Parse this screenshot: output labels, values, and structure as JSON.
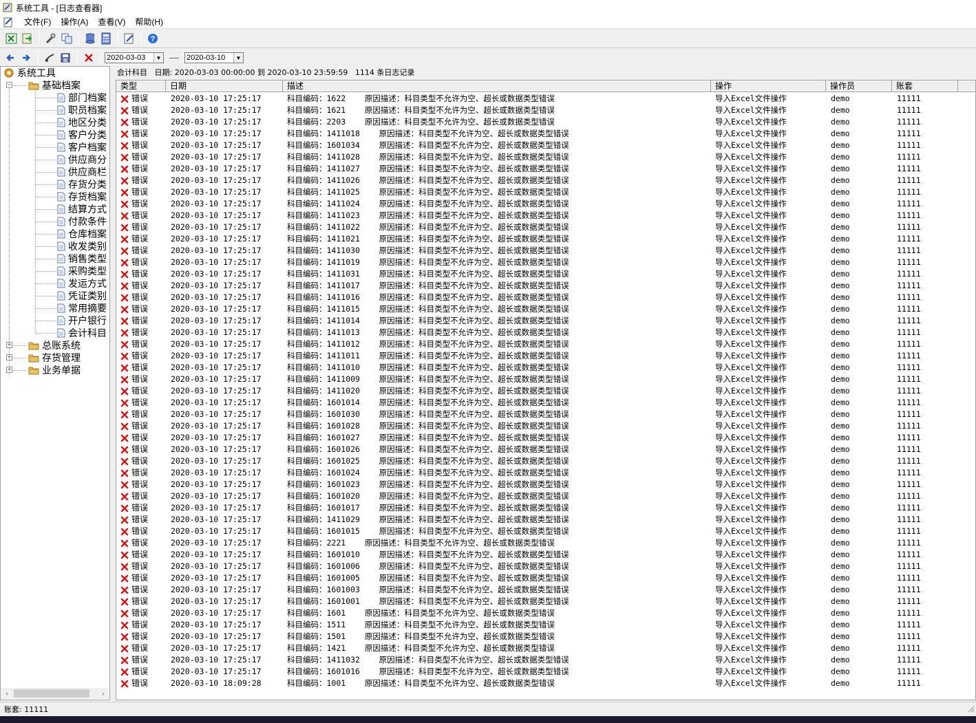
{
  "window": {
    "title": "系统工具 - [日志查看器]"
  },
  "menu": [
    {
      "label": "文件(F)"
    },
    {
      "label": "操作(A)"
    },
    {
      "label": "查看(V)"
    },
    {
      "label": "帮助(H)"
    }
  ],
  "filter": {
    "date_from": "2020-03-03",
    "date_to": "2020-03-10"
  },
  "tree": {
    "root": "系统工具",
    "groups": [
      {
        "label": "基础档案",
        "expanded": true,
        "children": [
          "部门档案",
          "职员档案",
          "地区分类",
          "客户分类",
          "客户档案",
          "供应商分",
          "供应商栏",
          "存货分类",
          "存货档案",
          "结算方式",
          "付款条件",
          "仓库档案",
          "收发类别",
          "销售类型",
          "采购类型",
          "发运方式",
          "凭证类别",
          "常用摘要",
          "开户银行",
          "会计科目"
        ]
      },
      {
        "label": "总账系统",
        "expanded": false
      },
      {
        "label": "存货管理",
        "expanded": false
      },
      {
        "label": "业务单据",
        "expanded": false
      }
    ]
  },
  "info": {
    "category": "会计科目",
    "date_label": "日期:",
    "range": "2020-03-03 00:00:00 到 2020-03-10 23:59:59",
    "count_text": "1114 条日志记录"
  },
  "columns": [
    "类型",
    "日期",
    "描述",
    "操作",
    "操作员",
    "账套"
  ],
  "rows": [
    {
      "type": "错误",
      "date": "2020-03-10 17:25:17",
      "desc": "科目编码：1622    原因描述：科目类型不允许为空、超长或数据类型错误",
      "op": "导入Excel文件操作",
      "user": "demo",
      "book": "11111"
    },
    {
      "type": "错误",
      "date": "2020-03-10 17:25:17",
      "desc": "科目编码：1621    原因描述：科目类型不允许为空、超长或数据类型错误",
      "op": "导入Excel文件操作",
      "user": "demo",
      "book": "11111"
    },
    {
      "type": "错误",
      "date": "2020-03-10 17:25:17",
      "desc": "科目编码：2203    原因描述：科目类型不允许为空、超长或数据类型错误",
      "op": "导入Excel文件操作",
      "user": "demo",
      "book": "11111"
    },
    {
      "type": "错误",
      "date": "2020-03-10 17:25:17",
      "desc": "科目编码：1411018    原因描述：科目类型不允许为空、超长或数据类型错误",
      "op": "导入Excel文件操作",
      "user": "demo",
      "book": "11111"
    },
    {
      "type": "错误",
      "date": "2020-03-10 17:25:17",
      "desc": "科目编码：1601034    原因描述：科目类型不允许为空、超长或数据类型错误",
      "op": "导入Excel文件操作",
      "user": "demo",
      "book": "11111"
    },
    {
      "type": "错误",
      "date": "2020-03-10 17:25:17",
      "desc": "科目编码：1411028    原因描述：科目类型不允许为空、超长或数据类型错误",
      "op": "导入Excel文件操作",
      "user": "demo",
      "book": "11111"
    },
    {
      "type": "错误",
      "date": "2020-03-10 17:25:17",
      "desc": "科目编码：1411027    原因描述：科目类型不允许为空、超长或数据类型错误",
      "op": "导入Excel文件操作",
      "user": "demo",
      "book": "11111"
    },
    {
      "type": "错误",
      "date": "2020-03-10 17:25:17",
      "desc": "科目编码：1411026    原因描述：科目类型不允许为空、超长或数据类型错误",
      "op": "导入Excel文件操作",
      "user": "demo",
      "book": "11111"
    },
    {
      "type": "错误",
      "date": "2020-03-10 17:25:17",
      "desc": "科目编码：1411025    原因描述：科目类型不允许为空、超长或数据类型错误",
      "op": "导入Excel文件操作",
      "user": "demo",
      "book": "11111"
    },
    {
      "type": "错误",
      "date": "2020-03-10 17:25:17",
      "desc": "科目编码：1411024    原因描述：科目类型不允许为空、超长或数据类型错误",
      "op": "导入Excel文件操作",
      "user": "demo",
      "book": "11111"
    },
    {
      "type": "错误",
      "date": "2020-03-10 17:25:17",
      "desc": "科目编码：1411023    原因描述：科目类型不允许为空、超长或数据类型错误",
      "op": "导入Excel文件操作",
      "user": "demo",
      "book": "11111"
    },
    {
      "type": "错误",
      "date": "2020-03-10 17:25:17",
      "desc": "科目编码：1411022    原因描述：科目类型不允许为空、超长或数据类型错误",
      "op": "导入Excel文件操作",
      "user": "demo",
      "book": "11111"
    },
    {
      "type": "错误",
      "date": "2020-03-10 17:25:17",
      "desc": "科目编码：1411021    原因描述：科目类型不允许为空、超长或数据类型错误",
      "op": "导入Excel文件操作",
      "user": "demo",
      "book": "11111"
    },
    {
      "type": "错误",
      "date": "2020-03-10 17:25:17",
      "desc": "科目编码：1411030    原因描述：科目类型不允许为空、超长或数据类型错误",
      "op": "导入Excel文件操作",
      "user": "demo",
      "book": "11111"
    },
    {
      "type": "错误",
      "date": "2020-03-10 17:25:17",
      "desc": "科目编码：1411019    原因描述：科目类型不允许为空、超长或数据类型错误",
      "op": "导入Excel文件操作",
      "user": "demo",
      "book": "11111"
    },
    {
      "type": "错误",
      "date": "2020-03-10 17:25:17",
      "desc": "科目编码：1411031    原因描述：科目类型不允许为空、超长或数据类型错误",
      "op": "导入Excel文件操作",
      "user": "demo",
      "book": "11111"
    },
    {
      "type": "错误",
      "date": "2020-03-10 17:25:17",
      "desc": "科目编码：1411017    原因描述：科目类型不允许为空、超长或数据类型错误",
      "op": "导入Excel文件操作",
      "user": "demo",
      "book": "11111"
    },
    {
      "type": "错误",
      "date": "2020-03-10 17:25:17",
      "desc": "科目编码：1411016    原因描述：科目类型不允许为空、超长或数据类型错误",
      "op": "导入Excel文件操作",
      "user": "demo",
      "book": "11111"
    },
    {
      "type": "错误",
      "date": "2020-03-10 17:25:17",
      "desc": "科目编码：1411015    原因描述：科目类型不允许为空、超长或数据类型错误",
      "op": "导入Excel文件操作",
      "user": "demo",
      "book": "11111"
    },
    {
      "type": "错误",
      "date": "2020-03-10 17:25:17",
      "desc": "科目编码：1411014    原因描述：科目类型不允许为空、超长或数据类型错误",
      "op": "导入Excel文件操作",
      "user": "demo",
      "book": "11111"
    },
    {
      "type": "错误",
      "date": "2020-03-10 17:25:17",
      "desc": "科目编码：1411013    原因描述：科目类型不允许为空、超长或数据类型错误",
      "op": "导入Excel文件操作",
      "user": "demo",
      "book": "11111"
    },
    {
      "type": "错误",
      "date": "2020-03-10 17:25:17",
      "desc": "科目编码：1411012    原因描述：科目类型不允许为空、超长或数据类型错误",
      "op": "导入Excel文件操作",
      "user": "demo",
      "book": "11111"
    },
    {
      "type": "错误",
      "date": "2020-03-10 17:25:17",
      "desc": "科目编码：1411011    原因描述：科目类型不允许为空、超长或数据类型错误",
      "op": "导入Excel文件操作",
      "user": "demo",
      "book": "11111"
    },
    {
      "type": "错误",
      "date": "2020-03-10 17:25:17",
      "desc": "科目编码：1411010    原因描述：科目类型不允许为空、超长或数据类型错误",
      "op": "导入Excel文件操作",
      "user": "demo",
      "book": "11111"
    },
    {
      "type": "错误",
      "date": "2020-03-10 17:25:17",
      "desc": "科目编码：1411009    原因描述：科目类型不允许为空、超长或数据类型错误",
      "op": "导入Excel文件操作",
      "user": "demo",
      "book": "11111"
    },
    {
      "type": "错误",
      "date": "2020-03-10 17:25:17",
      "desc": "科目编码：1411020    原因描述：科目类型不允许为空、超长或数据类型错误",
      "op": "导入Excel文件操作",
      "user": "demo",
      "book": "11111"
    },
    {
      "type": "错误",
      "date": "2020-03-10 17:25:17",
      "desc": "科目编码：1601014    原因描述：科目类型不允许为空、超长或数据类型错误",
      "op": "导入Excel文件操作",
      "user": "demo",
      "book": "11111"
    },
    {
      "type": "错误",
      "date": "2020-03-10 17:25:17",
      "desc": "科目编码：1601030    原因描述：科目类型不允许为空、超长或数据类型错误",
      "op": "导入Excel文件操作",
      "user": "demo",
      "book": "11111"
    },
    {
      "type": "错误",
      "date": "2020-03-10 17:25:17",
      "desc": "科目编码：1601028    原因描述：科目类型不允许为空、超长或数据类型错误",
      "op": "导入Excel文件操作",
      "user": "demo",
      "book": "11111"
    },
    {
      "type": "错误",
      "date": "2020-03-10 17:25:17",
      "desc": "科目编码：1601027    原因描述：科目类型不允许为空、超长或数据类型错误",
      "op": "导入Excel文件操作",
      "user": "demo",
      "book": "11111"
    },
    {
      "type": "错误",
      "date": "2020-03-10 17:25:17",
      "desc": "科目编码：1601026    原因描述：科目类型不允许为空、超长或数据类型错误",
      "op": "导入Excel文件操作",
      "user": "demo",
      "book": "11111"
    },
    {
      "type": "错误",
      "date": "2020-03-10 17:25:17",
      "desc": "科目编码：1601025    原因描述：科目类型不允许为空、超长或数据类型错误",
      "op": "导入Excel文件操作",
      "user": "demo",
      "book": "11111"
    },
    {
      "type": "错误",
      "date": "2020-03-10 17:25:17",
      "desc": "科目编码：1601024    原因描述：科目类型不允许为空、超长或数据类型错误",
      "op": "导入Excel文件操作",
      "user": "demo",
      "book": "11111"
    },
    {
      "type": "错误",
      "date": "2020-03-10 17:25:17",
      "desc": "科目编码：1601023    原因描述：科目类型不允许为空、超长或数据类型错误",
      "op": "导入Excel文件操作",
      "user": "demo",
      "book": "11111"
    },
    {
      "type": "错误",
      "date": "2020-03-10 17:25:17",
      "desc": "科目编码：1601020    原因描述：科目类型不允许为空、超长或数据类型错误",
      "op": "导入Excel文件操作",
      "user": "demo",
      "book": "11111"
    },
    {
      "type": "错误",
      "date": "2020-03-10 17:25:17",
      "desc": "科目编码：1601017    原因描述：科目类型不允许为空、超长或数据类型错误",
      "op": "导入Excel文件操作",
      "user": "demo",
      "book": "11111"
    },
    {
      "type": "错误",
      "date": "2020-03-10 17:25:17",
      "desc": "科目编码：1411029    原因描述：科目类型不允许为空、超长或数据类型错误",
      "op": "导入Excel文件操作",
      "user": "demo",
      "book": "11111"
    },
    {
      "type": "错误",
      "date": "2020-03-10 17:25:17",
      "desc": "科目编码：1601015    原因描述：科目类型不允许为空、超长或数据类型错误",
      "op": "导入Excel文件操作",
      "user": "demo",
      "book": "11111"
    },
    {
      "type": "错误",
      "date": "2020-03-10 17:25:17",
      "desc": "科目编码：2221    原因描述：科目类型不允许为空、超长或数据类型错误",
      "op": "导入Excel文件操作",
      "user": "demo",
      "book": "11111"
    },
    {
      "type": "错误",
      "date": "2020-03-10 17:25:17",
      "desc": "科目编码：1601010    原因描述：科目类型不允许为空、超长或数据类型错误",
      "op": "导入Excel文件操作",
      "user": "demo",
      "book": "11111"
    },
    {
      "type": "错误",
      "date": "2020-03-10 17:25:17",
      "desc": "科目编码：1601006    原因描述：科目类型不允许为空、超长或数据类型错误",
      "op": "导入Excel文件操作",
      "user": "demo",
      "book": "11111"
    },
    {
      "type": "错误",
      "date": "2020-03-10 17:25:17",
      "desc": "科目编码：1601005    原因描述：科目类型不允许为空、超长或数据类型错误",
      "op": "导入Excel文件操作",
      "user": "demo",
      "book": "11111"
    },
    {
      "type": "错误",
      "date": "2020-03-10 17:25:17",
      "desc": "科目编码：1601003    原因描述：科目类型不允许为空、超长或数据类型错误",
      "op": "导入Excel文件操作",
      "user": "demo",
      "book": "11111"
    },
    {
      "type": "错误",
      "date": "2020-03-10 17:25:17",
      "desc": "科目编码：1601001    原因描述：科目类型不允许为空、超长或数据类型错误",
      "op": "导入Excel文件操作",
      "user": "demo",
      "book": "11111"
    },
    {
      "type": "错误",
      "date": "2020-03-10 17:25:17",
      "desc": "科目编码：1601    原因描述：科目类型不允许为空、超长或数据类型错误",
      "op": "导入Excel文件操作",
      "user": "demo",
      "book": "11111"
    },
    {
      "type": "错误",
      "date": "2020-03-10 17:25:17",
      "desc": "科目编码：1511    原因描述：科目类型不允许为空、超长或数据类型错误",
      "op": "导入Excel文件操作",
      "user": "demo",
      "book": "11111"
    },
    {
      "type": "错误",
      "date": "2020-03-10 17:25:17",
      "desc": "科目编码：1501    原因描述：科目类型不允许为空、超长或数据类型错误",
      "op": "导入Excel文件操作",
      "user": "demo",
      "book": "11111"
    },
    {
      "type": "错误",
      "date": "2020-03-10 17:25:17",
      "desc": "科目编码：1421    原因描述：科目类型不允许为空、超长或数据类型错误",
      "op": "导入Excel文件操作",
      "user": "demo",
      "book": "11111"
    },
    {
      "type": "错误",
      "date": "2020-03-10 17:25:17",
      "desc": "科目编码：1411032    原因描述：科目类型不允许为空、超长或数据类型错误",
      "op": "导入Excel文件操作",
      "user": "demo",
      "book": "11111"
    },
    {
      "type": "错误",
      "date": "2020-03-10 17:25:17",
      "desc": "科目编码：1601016    原因描述：科目类型不允许为空、超长或数据类型错误",
      "op": "导入Excel文件操作",
      "user": "demo",
      "book": "11111"
    },
    {
      "type": "错误",
      "date": "2020-03-10 18:09:28",
      "desc": "科目编码：1001    原因描述：科目类型不允许为空、超长或数据类型错误",
      "op": "导入Excel文件操作",
      "user": "demo",
      "book": "11111"
    }
  ],
  "status": {
    "text": "账套: 11111"
  }
}
